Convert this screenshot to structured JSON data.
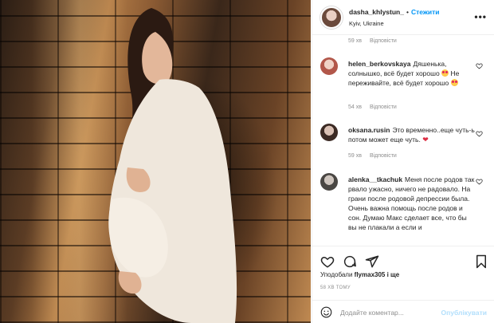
{
  "post": {
    "username": "dasha_khlystun_",
    "separator": "•",
    "follow_label": "Стежити",
    "location": "Kyiv, Ukraine",
    "more_label": "•••"
  },
  "top_meta": {
    "time": "59 хв",
    "reply": "Відповісти"
  },
  "comments": [
    {
      "user": "helen_berkovskaya",
      "text_1": "Дяшенька, солнышко, всё будет хорошо",
      "text_2": "Не переживайте, всё будет хорошо",
      "time": "54 хв",
      "reply": "Відповісти"
    },
    {
      "user": "oksana.rusin",
      "text": "Это временно..еще чуть-ь потом может еще чуть.",
      "time": "59 хв",
      "reply": "Відповісти"
    },
    {
      "user": "alenka__tkachuk",
      "text": "Меня после родов так рвало ужасно, ничего не радовало. На грани после родовой депрессии была. Очень важна помощь после родов и сон. Думаю Макс сделает все, что бы вы не плакали а если и"
    }
  ],
  "likes": {
    "prefix": "Уподобали",
    "user": "flymax305",
    "suffix": "і ще"
  },
  "post_time": "58 ХВ ТОМУ",
  "composer": {
    "placeholder": "Додайте коментар...",
    "post_label": "Опублікувати"
  },
  "colors": {
    "accent": "#0095f6",
    "muted": "#8e8e8e",
    "post_disabled": "#b2dffc"
  },
  "icons": [
    "more-icon",
    "heart-icon",
    "comment-icon",
    "share-icon",
    "bookmark-icon",
    "smile-icon"
  ]
}
